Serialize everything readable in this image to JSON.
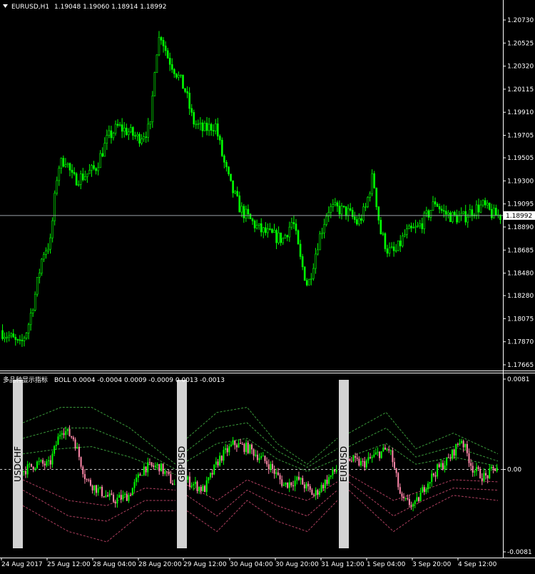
{
  "main_panel": {
    "symbol_label": "EURUSD,H1",
    "ohlc_label": "1.19048 1.19060 1.18914 1.18992",
    "current_price_label": "1.18992",
    "current_price": 1.18992,
    "price_ticks": [
      "1.20730",
      "1.20525",
      "1.20320",
      "1.20115",
      "1.19910",
      "1.19705",
      "1.19505",
      "1.19300",
      "1.19095",
      "1.18890",
      "1.18685",
      "1.18480",
      "1.18280",
      "1.18075",
      "1.17870",
      "1.17665"
    ],
    "price_tick_values": [
      1.2073,
      1.20525,
      1.2032,
      1.20115,
      1.1991,
      1.19705,
      1.19505,
      1.193,
      1.19095,
      1.1889,
      1.18685,
      1.1848,
      1.1828,
      1.18075,
      1.1787,
      1.17665
    ]
  },
  "sub_panel": {
    "indicator_label": "多品种显示指标",
    "boll_label": "BOLL 0.0004 -0.0004 0.0009 -0.0009 0.0013 -0.0013",
    "ticks": [
      "0.0081",
      "0.00",
      "-0.0081"
    ],
    "tick_values": [
      0.0081,
      0,
      -0.0081
    ],
    "symbol_tags": [
      "USDCHF",
      "GBPUSD",
      "EURUSD"
    ]
  },
  "time_axis": {
    "labels": [
      "24 Aug 2017",
      "25 Aug 12:00",
      "28 Aug 04:00",
      "28 Aug 20:00",
      "29 Aug 12:00",
      "30 Aug 04:00",
      "30 Aug 20:00",
      "31 Aug 12:00",
      "1 Sep 04:00",
      "3 Sep 20:00",
      "4 Sep 12:00"
    ]
  },
  "colors": {
    "background": "#000000",
    "bull": "#00ff00",
    "bear": "#ff88aa",
    "band_upper": "#3a9a3a",
    "band_lower": "#b04060",
    "axis_text": "#ffffff",
    "price_line": "#9aa0a8"
  },
  "chart_data": [
    {
      "type": "candlestick",
      "symbol": "EURUSD",
      "timeframe": "H1",
      "ylim": [
        1.17665,
        1.2073
      ],
      "path": [
        [
          0,
          1.1797
        ],
        [
          0.02,
          1.1791
        ],
        [
          0.04,
          1.1783
        ],
        [
          0.055,
          1.18
        ],
        [
          0.07,
          1.183
        ],
        [
          0.085,
          1.1866
        ],
        [
          0.1,
          1.1875
        ],
        [
          0.115,
          1.1942
        ],
        [
          0.13,
          1.195
        ],
        [
          0.145,
          1.1931
        ],
        [
          0.165,
          1.1934
        ],
        [
          0.19,
          1.1941
        ],
        [
          0.215,
          1.1968
        ],
        [
          0.235,
          1.1978
        ],
        [
          0.255,
          1.1974
        ],
        [
          0.275,
          1.1968
        ],
        [
          0.3,
          1.1977
        ],
        [
          0.31,
          1.204
        ],
        [
          0.32,
          1.2062
        ],
        [
          0.335,
          1.204
        ],
        [
          0.35,
          1.2028
        ],
        [
          0.37,
          1.201
        ],
        [
          0.385,
          1.1983
        ],
        [
          0.405,
          1.1975
        ],
        [
          0.43,
          1.198
        ],
        [
          0.445,
          1.195
        ],
        [
          0.46,
          1.1926
        ],
        [
          0.48,
          1.1905
        ],
        [
          0.5,
          1.1895
        ],
        [
          0.52,
          1.1886
        ],
        [
          0.54,
          1.1882
        ],
        [
          0.565,
          1.1878
        ],
        [
          0.585,
          1.1895
        ],
        [
          0.6,
          1.186
        ],
        [
          0.615,
          1.1836
        ],
        [
          0.635,
          1.1875
        ],
        [
          0.655,
          1.1905
        ],
        [
          0.675,
          1.1905
        ],
        [
          0.695,
          1.1902
        ],
        [
          0.715,
          1.1892
        ],
        [
          0.73,
          1.1905
        ],
        [
          0.745,
          1.1935
        ],
        [
          0.76,
          1.1885
        ],
        [
          0.775,
          1.1868
        ],
        [
          0.79,
          1.1866
        ],
        [
          0.81,
          1.1883
        ],
        [
          0.835,
          1.1888
        ],
        [
          0.855,
          1.19
        ],
        [
          0.87,
          1.1912
        ],
        [
          0.885,
          1.1902
        ],
        [
          0.905,
          1.1898
        ],
        [
          0.925,
          1.1897
        ],
        [
          0.945,
          1.1904
        ],
        [
          0.965,
          1.1908
        ],
        [
          0.985,
          1.19
        ],
        [
          1,
          1.1899
        ]
      ]
    },
    {
      "type": "multi-symbol-oscillator-with-bollinger",
      "ylim": [
        -0.0081,
        0.0081
      ],
      "boll_levels": [
        0.0004,
        -0.0004,
        0.0009,
        -0.0009,
        0.0013,
        -0.0013
      ],
      "segments": [
        {
          "name": "USDCHF",
          "osc_path": [
            [
              0,
              -0.0002
            ],
            [
              0.1,
              0.0006
            ],
            [
              0.18,
              0.0004
            ],
            [
              0.26,
              0.004
            ],
            [
              0.34,
              0.003
            ],
            [
              0.42,
              -0.001
            ],
            [
              0.5,
              -0.002
            ],
            [
              0.6,
              -0.003
            ],
            [
              0.7,
              -0.0025
            ],
            [
              0.8,
              0.0002
            ],
            [
              0.9,
              0.0003
            ],
            [
              1,
              -0.0015
            ]
          ],
          "upper_bands": [
            [
              [
                0,
                0.0045
              ],
              [
                0.25,
                0.006
              ],
              [
                0.45,
                0.006
              ],
              [
                0.7,
                0.004
              ],
              [
                1,
                0.0005
              ]
            ],
            [
              [
                0,
                0.003
              ],
              [
                0.25,
                0.004
              ],
              [
                0.45,
                0.004
              ],
              [
                0.7,
                0.0025
              ],
              [
                1,
                0.0
              ]
            ],
            [
              [
                0,
                0.0015
              ],
              [
                0.25,
                0.002
              ],
              [
                0.45,
                0.0022
              ],
              [
                0.7,
                0.0012
              ],
              [
                1,
                -0.0005
              ]
            ]
          ],
          "lower_bands": [
            [
              [
                0,
                -0.0035
              ],
              [
                0.3,
                -0.006
              ],
              [
                0.55,
                -0.007
              ],
              [
                0.8,
                -0.004
              ],
              [
                1,
                -0.004
              ]
            ],
            [
              [
                0,
                -0.002
              ],
              [
                0.3,
                -0.0045
              ],
              [
                0.55,
                -0.005
              ],
              [
                0.8,
                -0.003
              ],
              [
                1,
                -0.003
              ]
            ],
            [
              [
                0,
                -0.001
              ],
              [
                0.3,
                -0.003
              ],
              [
                0.55,
                -0.0035
              ],
              [
                0.8,
                -0.0018
              ],
              [
                1,
                -0.002
              ]
            ]
          ]
        },
        {
          "name": "GBPUSD",
          "osc_path": [
            [
              0,
              -0.001
            ],
            [
              0.12,
              -0.002
            ],
            [
              0.22,
              0.001
            ],
            [
              0.32,
              0.0025
            ],
            [
              0.42,
              0.002
            ],
            [
              0.55,
              0.0005
            ],
            [
              0.65,
              -0.0015
            ],
            [
              0.75,
              -0.001
            ],
            [
              0.85,
              -0.0025
            ],
            [
              1,
              0.0
            ]
          ],
          "upper_bands": [
            [
              [
                0,
                0.003
              ],
              [
                0.2,
                0.0055
              ],
              [
                0.4,
                0.006
              ],
              [
                0.6,
                0.0025
              ],
              [
                0.8,
                0.0005
              ],
              [
                1,
                0.003
              ]
            ],
            [
              [
                0,
                0.0018
              ],
              [
                0.2,
                0.004
              ],
              [
                0.4,
                0.0045
              ],
              [
                0.6,
                0.0018
              ],
              [
                0.8,
                0.0002
              ],
              [
                1,
                0.002
              ]
            ],
            [
              [
                0,
                0.0008
              ],
              [
                0.2,
                0.0025
              ],
              [
                0.4,
                0.003
              ],
              [
                0.6,
                0.001
              ],
              [
                0.8,
                -0.0002
              ],
              [
                1,
                0.001
              ]
            ]
          ],
          "lower_bands": [
            [
              [
                0,
                -0.004
              ],
              [
                0.2,
                -0.006
              ],
              [
                0.4,
                -0.003
              ],
              [
                0.6,
                -0.005
              ],
              [
                0.8,
                -0.006
              ],
              [
                1,
                -0.003
              ]
            ],
            [
              [
                0,
                -0.0025
              ],
              [
                0.2,
                -0.0045
              ],
              [
                0.4,
                -0.002
              ],
              [
                0.6,
                -0.0035
              ],
              [
                0.8,
                -0.0045
              ],
              [
                1,
                -0.002
              ]
            ],
            [
              [
                0,
                -0.0015
              ],
              [
                0.2,
                -0.003
              ],
              [
                0.4,
                -0.001
              ],
              [
                0.6,
                -0.0022
              ],
              [
                0.8,
                -0.003
              ],
              [
                1,
                -0.0012
              ]
            ]
          ]
        },
        {
          "name": "EURUSD",
          "osc_path": [
            [
              0,
              0.001
            ],
            [
              0.1,
              0.0005
            ],
            [
              0.2,
              0.0015
            ],
            [
              0.28,
              0.002
            ],
            [
              0.36,
              -0.003
            ],
            [
              0.45,
              -0.0035
            ],
            [
              0.52,
              -0.0015
            ],
            [
              0.6,
              0.0
            ],
            [
              0.68,
              0.001
            ],
            [
              0.76,
              0.003
            ],
            [
              0.84,
              0.0
            ],
            [
              0.92,
              -0.0008
            ],
            [
              1,
              0.0003
            ]
          ],
          "upper_bands": [
            [
              [
                0,
                0.0035
              ],
              [
                0.25,
                0.0055
              ],
              [
                0.45,
                0.002
              ],
              [
                0.7,
                0.0035
              ],
              [
                1,
                0.0015
              ]
            ],
            [
              [
                0,
                0.0022
              ],
              [
                0.25,
                0.004
              ],
              [
                0.45,
                0.0012
              ],
              [
                0.7,
                0.0022
              ],
              [
                1,
                0.0008
              ]
            ],
            [
              [
                0,
                0.0012
              ],
              [
                0.25,
                0.0025
              ],
              [
                0.45,
                0.0005
              ],
              [
                0.7,
                0.0012
              ],
              [
                1,
                0.0003
              ]
            ]
          ],
          "lower_bands": [
            [
              [
                0,
                -0.002
              ],
              [
                0.3,
                -0.006
              ],
              [
                0.5,
                -0.004
              ],
              [
                0.7,
                -0.0025
              ],
              [
                1,
                -0.003
              ]
            ],
            [
              [
                0,
                -0.0012
              ],
              [
                0.3,
                -0.0045
              ],
              [
                0.5,
                -0.003
              ],
              [
                0.7,
                -0.0018
              ],
              [
                1,
                -0.002
              ]
            ],
            [
              [
                0,
                -0.0005
              ],
              [
                0.3,
                -0.003
              ],
              [
                0.5,
                -0.002
              ],
              [
                0.7,
                -0.001
              ],
              [
                1,
                -0.0012
              ]
            ]
          ]
        }
      ]
    }
  ]
}
